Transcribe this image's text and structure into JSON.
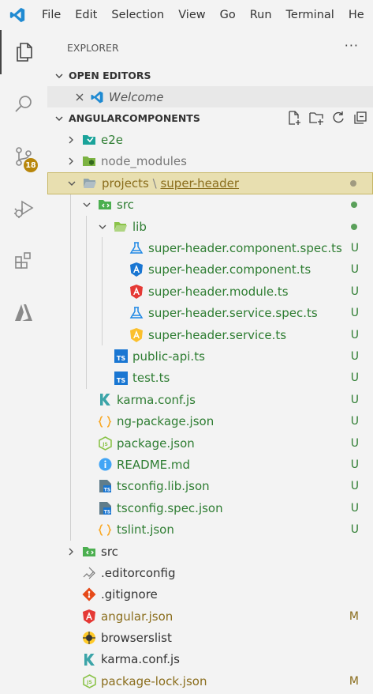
{
  "menubar": {
    "items": [
      "File",
      "Edit",
      "Selection",
      "View",
      "Go",
      "Run",
      "Terminal",
      "He"
    ]
  },
  "activitybar": {
    "source_control_badge": "18"
  },
  "explorer": {
    "title": "EXPLORER",
    "more": "···",
    "open_editors": {
      "label": "OPEN EDITORS",
      "items": [
        {
          "name": "Welcome"
        }
      ]
    },
    "workspace": {
      "label": "ANGULARCOMPONENTS"
    }
  },
  "tree": [
    {
      "indent": 0,
      "chevron": "right",
      "icon": "folder-e2e-icon",
      "name": "e2e",
      "color": "#2e7d32"
    },
    {
      "indent": 0,
      "chevron": "right",
      "icon": "folder-node-icon",
      "name": "node_modules",
      "color": "#777777"
    },
    {
      "indent": 0,
      "chevron": "down",
      "icon": "folder-open-icon",
      "name": "projects",
      "name2": "super-header",
      "color": "#8a6d1c",
      "dot": "#a09a80",
      "selected": true
    },
    {
      "indent": 1,
      "chevron": "down",
      "icon": "folder-src-icon",
      "name": "src",
      "color": "#2e7d32",
      "dot": "#5aa05a"
    },
    {
      "indent": 2,
      "chevron": "down",
      "icon": "folder-lib-icon",
      "name": "lib",
      "color": "#2e7d32",
      "dot": "#5aa05a"
    },
    {
      "indent": 3,
      "icon": "test-flask-icon",
      "name": "super-header.component.spec.ts",
      "color": "#2e7d32",
      "status": "U"
    },
    {
      "indent": 3,
      "icon": "angular-component-icon",
      "name": "super-header.component.ts",
      "color": "#2e7d32",
      "status": "U"
    },
    {
      "indent": 3,
      "icon": "angular-module-icon",
      "name": "super-header.module.ts",
      "color": "#2e7d32",
      "status": "U"
    },
    {
      "indent": 3,
      "icon": "test-flask-icon",
      "name": "super-header.service.spec.ts",
      "color": "#2e7d32",
      "status": "U"
    },
    {
      "indent": 3,
      "icon": "angular-service-icon",
      "name": "super-header.service.ts",
      "color": "#2e7d32",
      "status": "U"
    },
    {
      "indent": 2,
      "icon": "typescript-icon",
      "name": "public-api.ts",
      "color": "#2e7d32",
      "status": "U"
    },
    {
      "indent": 2,
      "icon": "typescript-icon",
      "name": "test.ts",
      "color": "#2e7d32",
      "status": "U"
    },
    {
      "indent": 1,
      "icon": "karma-icon",
      "name": "karma.conf.js",
      "color": "#2e7d32",
      "status": "U"
    },
    {
      "indent": 1,
      "icon": "json-braces-icon",
      "name": "ng-package.json",
      "color": "#2e7d32",
      "status": "U"
    },
    {
      "indent": 1,
      "icon": "nodejs-icon",
      "name": "package.json",
      "color": "#2e7d32",
      "status": "U"
    },
    {
      "indent": 1,
      "icon": "info-icon",
      "name": "README.md",
      "color": "#2e7d32",
      "status": "U"
    },
    {
      "indent": 1,
      "icon": "tsconfig-icon",
      "name": "tsconfig.lib.json",
      "color": "#2e7d32",
      "status": "U"
    },
    {
      "indent": 1,
      "icon": "tsconfig-icon",
      "name": "tsconfig.spec.json",
      "color": "#2e7d32",
      "status": "U"
    },
    {
      "indent": 1,
      "icon": "json-braces-icon",
      "name": "tslint.json",
      "color": "#2e7d32",
      "status": "U"
    },
    {
      "indent": 0,
      "chevron": "right",
      "icon": "folder-src-icon",
      "name": "src",
      "color": "#333333"
    },
    {
      "indent": 0,
      "icon": "editorconfig-icon",
      "name": ".editorconfig",
      "color": "#333333"
    },
    {
      "indent": 0,
      "icon": "git-icon",
      "name": ".gitignore",
      "color": "#333333"
    },
    {
      "indent": 0,
      "icon": "angular-icon",
      "name": "angular.json",
      "color": "#8a6d1c",
      "status": "M"
    },
    {
      "indent": 0,
      "icon": "browserslist-icon",
      "name": "browserslist",
      "color": "#333333"
    },
    {
      "indent": 0,
      "icon": "karma-icon",
      "name": "karma.conf.js",
      "color": "#333333"
    },
    {
      "indent": 0,
      "icon": "nodejs-icon",
      "name": "package-lock.json",
      "color": "#8a6d1c",
      "status": "M"
    }
  ]
}
